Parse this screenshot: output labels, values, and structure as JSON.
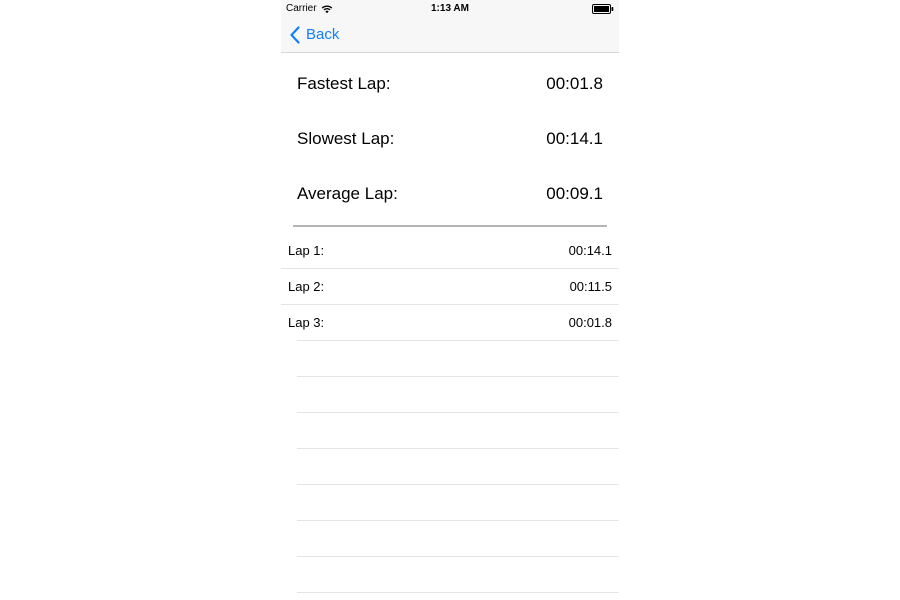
{
  "status_bar": {
    "carrier": "Carrier",
    "time": "1:13 AM",
    "wifi_icon": "wifi-icon",
    "battery_icon": "battery-icon"
  },
  "nav_bar": {
    "back_label": "Back",
    "back_icon": "chevron-left-icon",
    "tint_color": "#147efb"
  },
  "stats": {
    "fastest": {
      "label": "Fastest Lap:",
      "value": "00:01.8"
    },
    "slowest": {
      "label": "Slowest Lap:",
      "value": "00:14.1"
    },
    "average": {
      "label": "Average Lap:",
      "value": "00:09.1"
    }
  },
  "laps": [
    {
      "label": "Lap 1:",
      "time": "00:14.1"
    },
    {
      "label": "Lap 2:",
      "time": "00:11.5"
    },
    {
      "label": "Lap 3:",
      "time": "00:01.8"
    }
  ]
}
